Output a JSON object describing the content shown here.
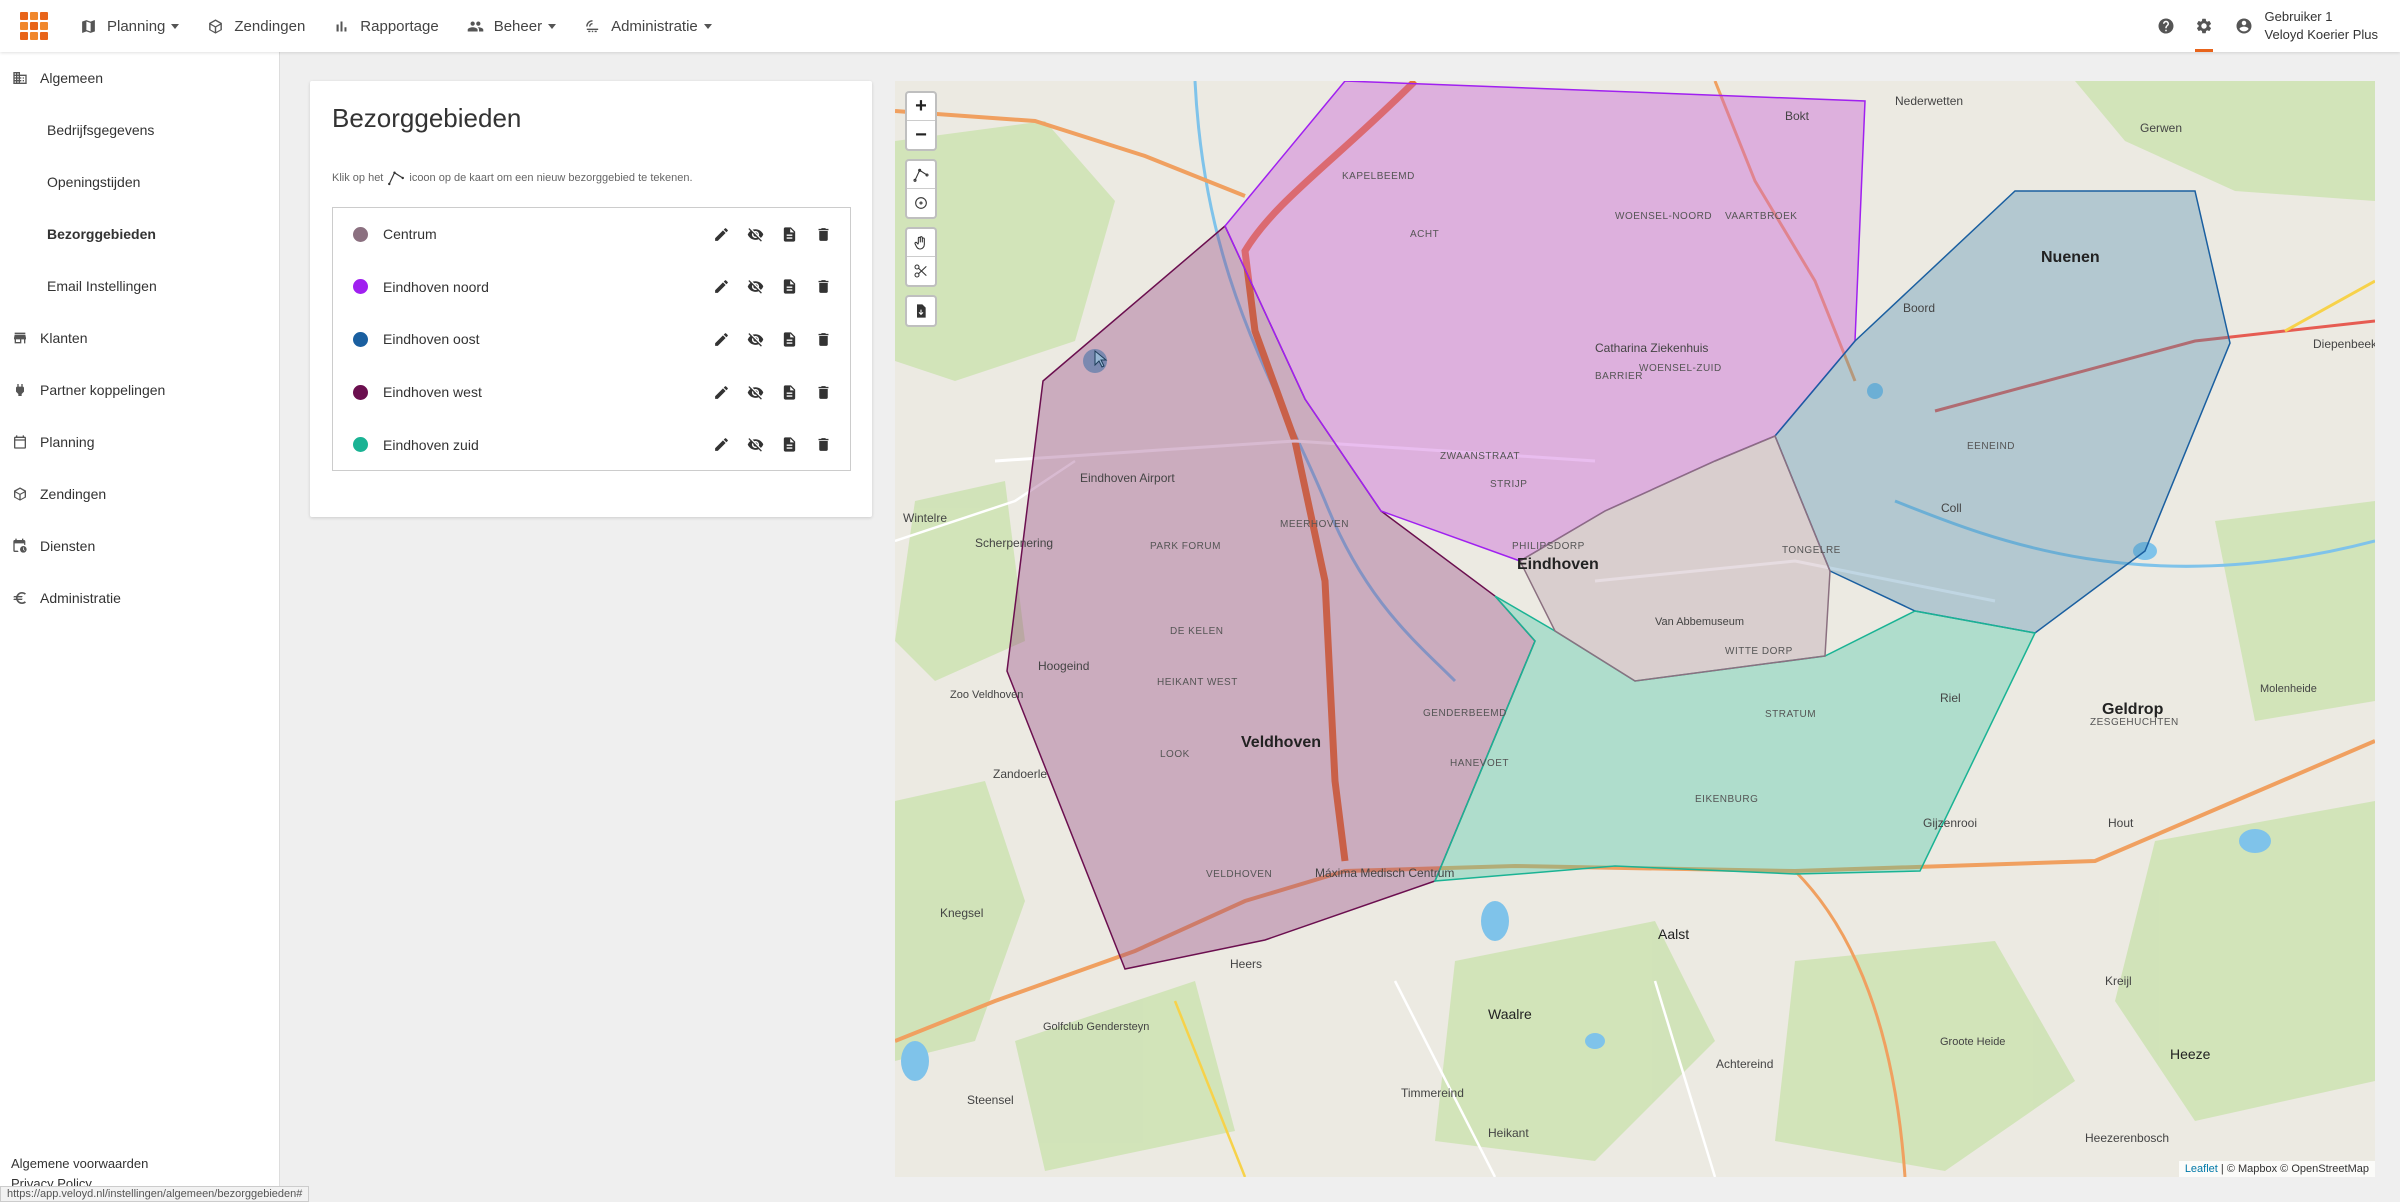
{
  "nav": {
    "items": [
      {
        "label": "Planning",
        "dropdown": true,
        "icon": "map-icon"
      },
      {
        "label": "Zendingen",
        "dropdown": false,
        "icon": "box-icon"
      },
      {
        "label": "Rapportage",
        "dropdown": false,
        "icon": "bar-chart-icon"
      },
      {
        "label": "Beheer",
        "dropdown": true,
        "icon": "people-icon"
      },
      {
        "label": "Administratie",
        "dropdown": true,
        "icon": "admin-icon"
      }
    ],
    "user": {
      "name": "Gebruiker 1",
      "company": "Veloyd Koerier Plus"
    }
  },
  "sidebar": {
    "section": {
      "label": "Algemeen",
      "icon": "building-icon"
    },
    "sub_items": [
      {
        "label": "Bedrijfsgegevens",
        "active": false
      },
      {
        "label": "Openingstijden",
        "active": false
      },
      {
        "label": "Bezorggebieden",
        "active": true
      },
      {
        "label": "Email Instellingen",
        "active": false
      }
    ],
    "items": [
      {
        "label": "Klanten",
        "icon": "store-icon"
      },
      {
        "label": "Partner koppelingen",
        "icon": "plug-icon"
      },
      {
        "label": "Planning",
        "icon": "calendar-icon"
      },
      {
        "label": "Zendingen",
        "icon": "box-icon"
      },
      {
        "label": "Diensten",
        "icon": "calendar-clock-icon"
      },
      {
        "label": "Administratie",
        "icon": "euro-icon"
      }
    ],
    "footer": {
      "terms": "Algemene voorwaarden",
      "privacy": "Privacy Policy"
    }
  },
  "statusbar": "https://app.veloyd.nl/instellingen/algemeen/bezorggebieden#",
  "panel": {
    "title": "Bezorggebieden",
    "hint_before": "Klik op het",
    "hint_after": "icoon op de kaart om een nieuw bezorggebied te tekenen.",
    "zones": [
      {
        "name": "Centrum",
        "color": "#8b7080"
      },
      {
        "name": "Eindhoven noord",
        "color": "#a020f0"
      },
      {
        "name": "Eindhoven oost",
        "color": "#1a5fa0"
      },
      {
        "name": "Eindhoven west",
        "color": "#6b0f4f"
      },
      {
        "name": "Eindhoven zuid",
        "color": "#1ab394"
      }
    ]
  },
  "map": {
    "zoom_in": "+",
    "zoom_out": "−",
    "labels": {
      "eindhoven": "Eindhoven",
      "veldhoven": "Veldhoven",
      "nuenen": "Nuenen",
      "geldrop": "Geldrop",
      "aalst": "Aalst",
      "waalre": "Waalre",
      "heeze": "Heeze",
      "airport": "Eindhoven Airport",
      "ziekenhuis": "Catharina Ziekenhuis",
      "maxima": "Máxima Medisch Centrum",
      "hoogeind": "Hoogeind",
      "zandoerle": "Zandoerle",
      "knegsel": "Knegsel",
      "heers": "Heers",
      "steensel": "Steensel",
      "riel": "Riel",
      "coll": "Coll",
      "boord": "Boord",
      "gerwen": "Gerwen",
      "nederwetten": "Nederwetten",
      "scherpenering": "Scherpenering",
      "wintelre": "Wintelre",
      "bokt": "Bokt",
      "diepenbeek": "Diepenbeek",
      "gijzenrooi": "Gijzenrooi",
      "hout": "Hout",
      "kreijl": "Kreijl",
      "heikant": "Heikant",
      "timmereind": "Timmereind",
      "achtereind": "Achtereind",
      "heezerenbosch": "Heezerenbosch",
      "woensel_noord": "WOENSEL-NOORD",
      "woensel_zuid": "WOENSEL-ZUID",
      "strijp": "STRIJP",
      "meerhoven": "MEERHOVEN",
      "stratum": "STRATUM",
      "tongelre": "TONGELRE",
      "eckart": "EENEIND",
      "de_kelen": "DE KELEN",
      "park_forum": "PARK FORUM",
      "heikant_west": "HEIKANT WEST",
      "look": "LOOK",
      "veldhoven_dorp": "VELDHOVEN",
      "zwaanstraat": "ZWAANSTRAAT",
      "barrier": "BARRIER",
      "acht": "ACHT",
      "kapelbeemd": "KAPELBEEMD",
      "vaartbroek": "VAARTBROEK",
      "hanevoet": "HANEVOET",
      "genderbeemd": "GENDERBEEMD",
      "eikenburg": "EIKENBURG",
      "witte_dorp": "WITTE DORP",
      "philipsdorp": "PHILIPSDORP",
      "van_abbemuseum": "Van Abbemuseum",
      "zoo_veldhoven": "Zoo Veldhoven",
      "grote_heide": "Groote Heide",
      "molenheide": "Molenheide",
      "zesgehuchten": "ZESGEHUCHTEN",
      "golfclub": "Golfclub Gendersteyn",
      "attribution_leaflet": "Leaflet",
      "attribution_rest": "| © Mapbox © OpenStreetMap"
    }
  }
}
